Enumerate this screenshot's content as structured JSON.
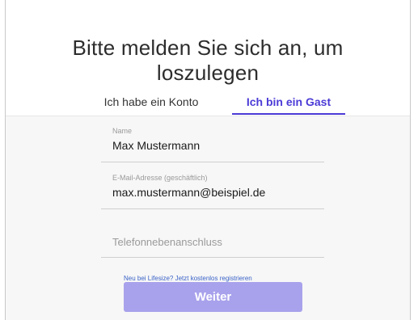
{
  "header": {
    "title": "Bitte melden Sie sich an, um loszulegen"
  },
  "tabs": {
    "account_label": "Ich habe ein Konto",
    "guest_label": "Ich bin ein Gast",
    "active": "guest",
    "accent_color": "#4b3bd6"
  },
  "form": {
    "name": {
      "label": "Name",
      "value": "Max Mustermann"
    },
    "email": {
      "label": "E-Mail-Adresse (geschäftlich)",
      "value": "max.mustermann@beispiel.de"
    },
    "extension": {
      "placeholder": "Telefonnebenanschluss",
      "value": ""
    }
  },
  "footer": {
    "register_link": "Neu bei Lifesize? Jetzt kostenlos registrieren",
    "continue_label": "Weiter",
    "button_color": "#a8a2ec"
  }
}
